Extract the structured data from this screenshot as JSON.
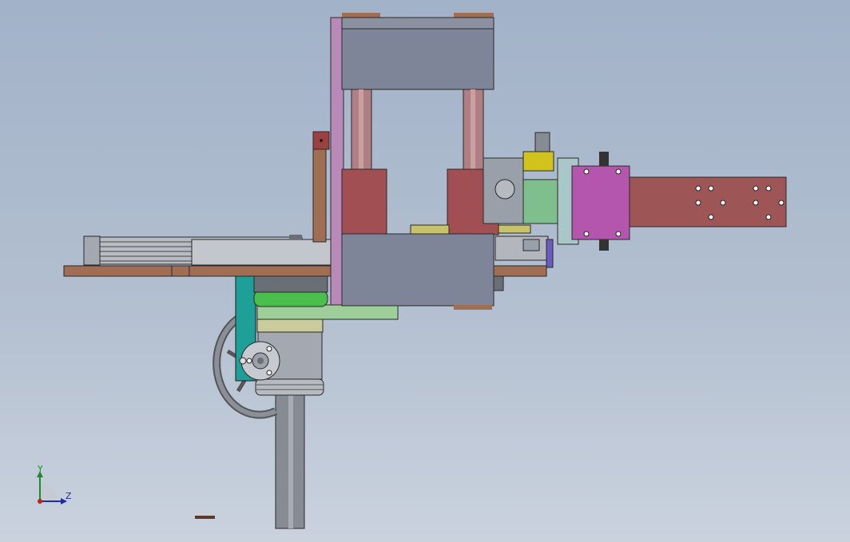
{
  "viewport": {
    "background_top": "#a2b2c8",
    "background_bottom": "#cad2de",
    "part_colors": {
      "frame_plate": "#7f8598",
      "column": "#b07f83",
      "cylinder": "#a24f53",
      "base_wood": "#a06e53",
      "arm": "#9e5556",
      "gear_housing": "#b456ad",
      "teal_bracket": "#1e9f98",
      "green_ring": "#4bbf4b",
      "olive_block": "#c8c26a",
      "yellow_block": "#d2c31c",
      "shaft": "#878b94"
    }
  },
  "triad": {
    "y_label": "Y",
    "z_label": "Z",
    "y_color": "#1f8a2a",
    "z_color": "#1f2f9a",
    "x_color": "#c21f1f"
  }
}
